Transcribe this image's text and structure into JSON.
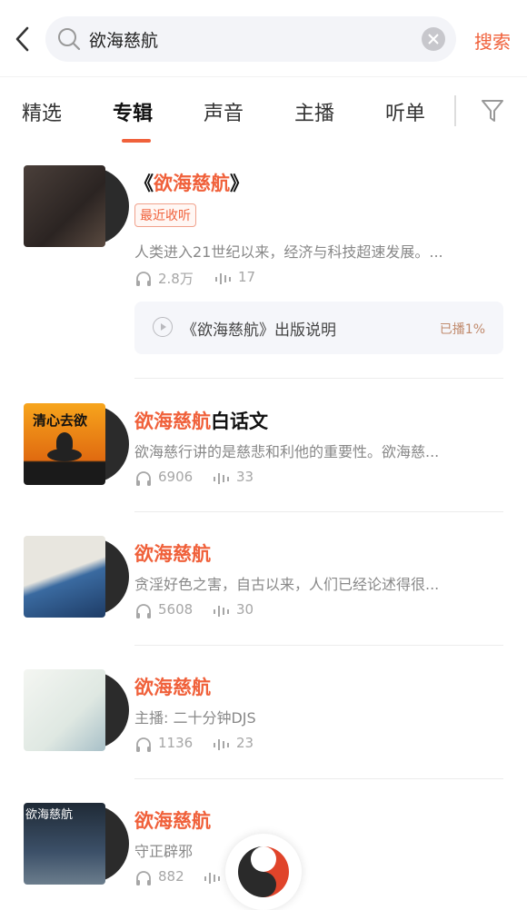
{
  "search": {
    "query": "欲海慈航",
    "button_label": "搜索"
  },
  "tabs": [
    {
      "label": "精选"
    },
    {
      "label": "专辑"
    },
    {
      "label": "声音"
    },
    {
      "label": "主播"
    },
    {
      "label": "听单"
    }
  ],
  "albums": [
    {
      "title_prefix": "《",
      "title_highlight": "欲海慈航",
      "title_suffix": "》",
      "badge": "最近收听",
      "desc": "人类进入21世纪以来，经济与科技超速发展。...",
      "plays": "2.8万",
      "tracks": "17",
      "recent_track": {
        "title": "《欲海慈航》出版说明",
        "played": "已播1%"
      }
    },
    {
      "title_highlight": "欲海慈航",
      "title_suffix": "白话文",
      "cover_text": "清心去欲",
      "desc": "欲海慈行讲的是慈悲和利他的重要性。欲海慈...",
      "plays": "6906",
      "tracks": "33"
    },
    {
      "title_highlight": "欲海慈航",
      "desc": "贪淫好色之害，自古以来，人们已经论述得很...",
      "plays": "5608",
      "tracks": "30"
    },
    {
      "title_highlight": "欲海慈航",
      "desc": "主播: 二十分钟DJS",
      "plays": "1136",
      "tracks": "23"
    },
    {
      "title_highlight": "欲海慈航",
      "cover_text": "欲海慈航",
      "desc": "守正辟邪",
      "plays": "882",
      "tracks": ""
    }
  ],
  "colors": {
    "accent": "#f0613b",
    "muted": "#a6a6a6"
  }
}
